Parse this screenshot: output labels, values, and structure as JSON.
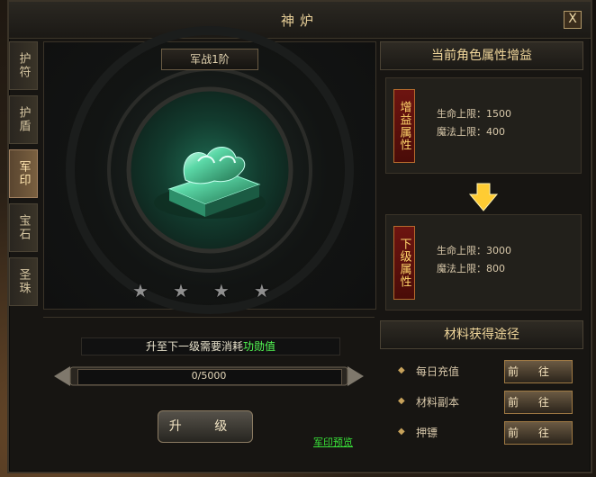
{
  "window": {
    "title": "神炉",
    "close": "X"
  },
  "tabs": [
    {
      "label": "护符"
    },
    {
      "label": "护盾"
    },
    {
      "label": "军印"
    },
    {
      "label": "宝石"
    },
    {
      "label": "圣珠"
    }
  ],
  "item": {
    "level_label": "军战1阶",
    "stars_total": 4,
    "stars_filled": 0
  },
  "stats": {
    "header": "当前角色属性增益",
    "current": {
      "title": "增益属性",
      "hp": "生命上限：1500",
      "mp": "魔法上限：400"
    },
    "next": {
      "title": "下级属性",
      "hp": "生命上限：3000",
      "mp": "魔法上限：800"
    }
  },
  "upgrade": {
    "requirement_prefix": "升至下一级需要消耗",
    "requirement_highlight": "功勋值",
    "progress_text": "0/5000",
    "progress_value": 0,
    "button": "升 级",
    "preview_link": "军印预览"
  },
  "materials": {
    "header": "材料获得途径",
    "items": [
      {
        "label": "每日充值",
        "button": "前往"
      },
      {
        "label": "材料副本",
        "button": "前往"
      },
      {
        "label": "押镖",
        "button": "前往"
      }
    ]
  },
  "colors": {
    "accent": "#e8cf98",
    "highlight": "#55ff55",
    "link": "#39e339"
  }
}
